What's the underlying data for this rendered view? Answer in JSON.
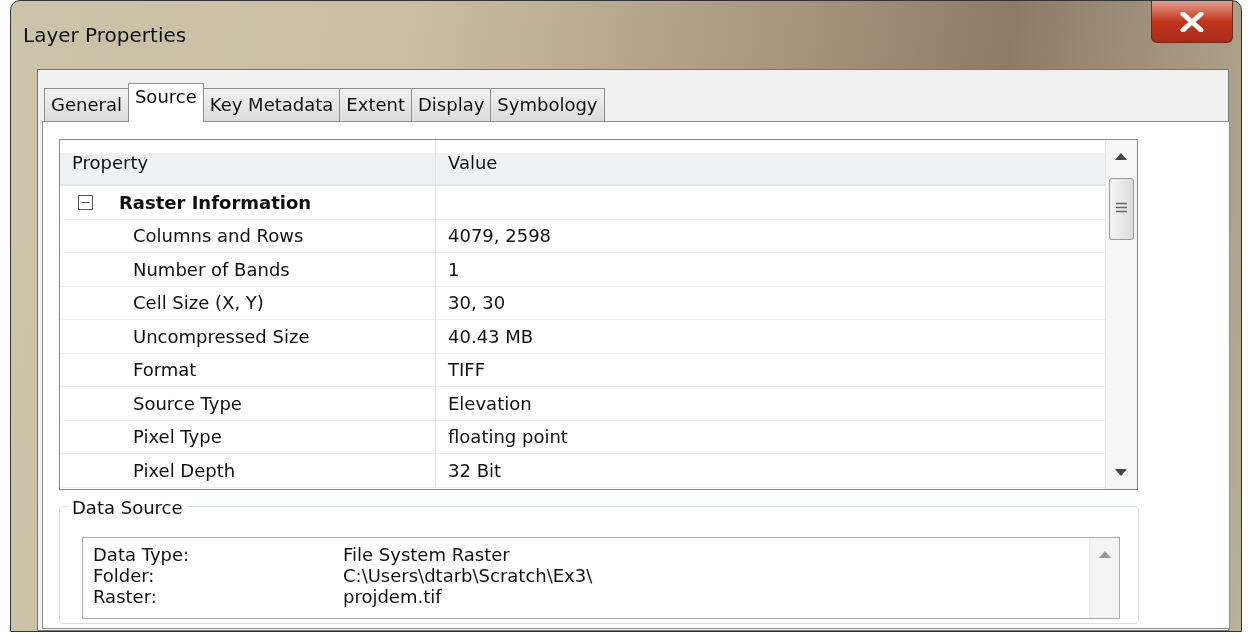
{
  "window": {
    "title": "Layer Properties"
  },
  "tabs": [
    {
      "label": "General",
      "selected": false
    },
    {
      "label": "Source",
      "selected": true
    },
    {
      "label": "Key Metadata",
      "selected": false
    },
    {
      "label": "Extent",
      "selected": false
    },
    {
      "label": "Display",
      "selected": false
    },
    {
      "label": "Symbology",
      "selected": false
    }
  ],
  "property_grid": {
    "columns": [
      "Property",
      "Value"
    ],
    "groups": [
      {
        "label": "Raster Information",
        "expanded": true,
        "children": [
          {
            "property": "Columns and Rows",
            "value": "4079, 2598"
          },
          {
            "property": "Number of Bands",
            "value": "1"
          },
          {
            "property": "Cell Size (X, Y)",
            "value": "30, 30"
          },
          {
            "property": "Uncompressed Size",
            "value": "40.43 MB"
          },
          {
            "property": "Format",
            "value": "TIFF"
          },
          {
            "property": "Source Type",
            "value": "Elevation"
          },
          {
            "property": "Pixel Type",
            "value": "floating point"
          },
          {
            "property": "Pixel Depth",
            "value": "32 Bit"
          }
        ]
      }
    ]
  },
  "data_source": {
    "title": "Data Source",
    "rows": [
      {
        "label": "Data Type:",
        "value": "File System Raster"
      },
      {
        "label": "Folder:",
        "value": "C:\\Users\\dtarb\\Scratch\\Ex3\\"
      },
      {
        "label": "Raster:",
        "value": "projdem.tif"
      }
    ]
  }
}
